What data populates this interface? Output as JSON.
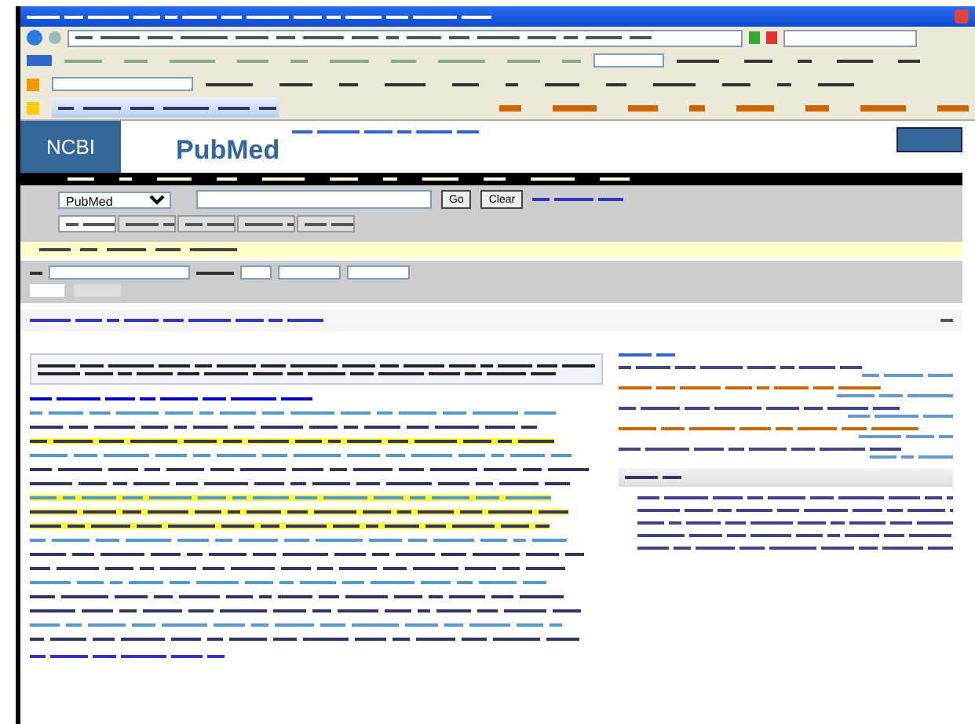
{
  "header": {
    "logo": "NCBI",
    "brand": "PubMed"
  },
  "search": {
    "database": "PubMed",
    "buttons": [
      "Go",
      "Clear"
    ]
  },
  "tabs": [
    {
      "selected": true
    },
    {
      "selected": false
    },
    {
      "selected": false
    },
    {
      "selected": false
    },
    {
      "selected": false
    }
  ],
  "abstract": {
    "lines": [
      {
        "highlighted": false
      },
      {
        "highlighted": false
      },
      {
        "highlighted": true
      },
      {
        "highlighted": false
      },
      {
        "highlighted": false
      },
      {
        "highlighted": false
      },
      {
        "highlighted": true
      },
      {
        "highlighted": true
      },
      {
        "highlighted": true
      },
      {
        "highlighted": false
      },
      {
        "highlighted": false
      },
      {
        "highlighted": false
      },
      {
        "highlighted": false
      },
      {
        "highlighted": false
      },
      {
        "highlighted": false
      },
      {
        "highlighted": false
      },
      {
        "highlighted": false
      }
    ]
  }
}
